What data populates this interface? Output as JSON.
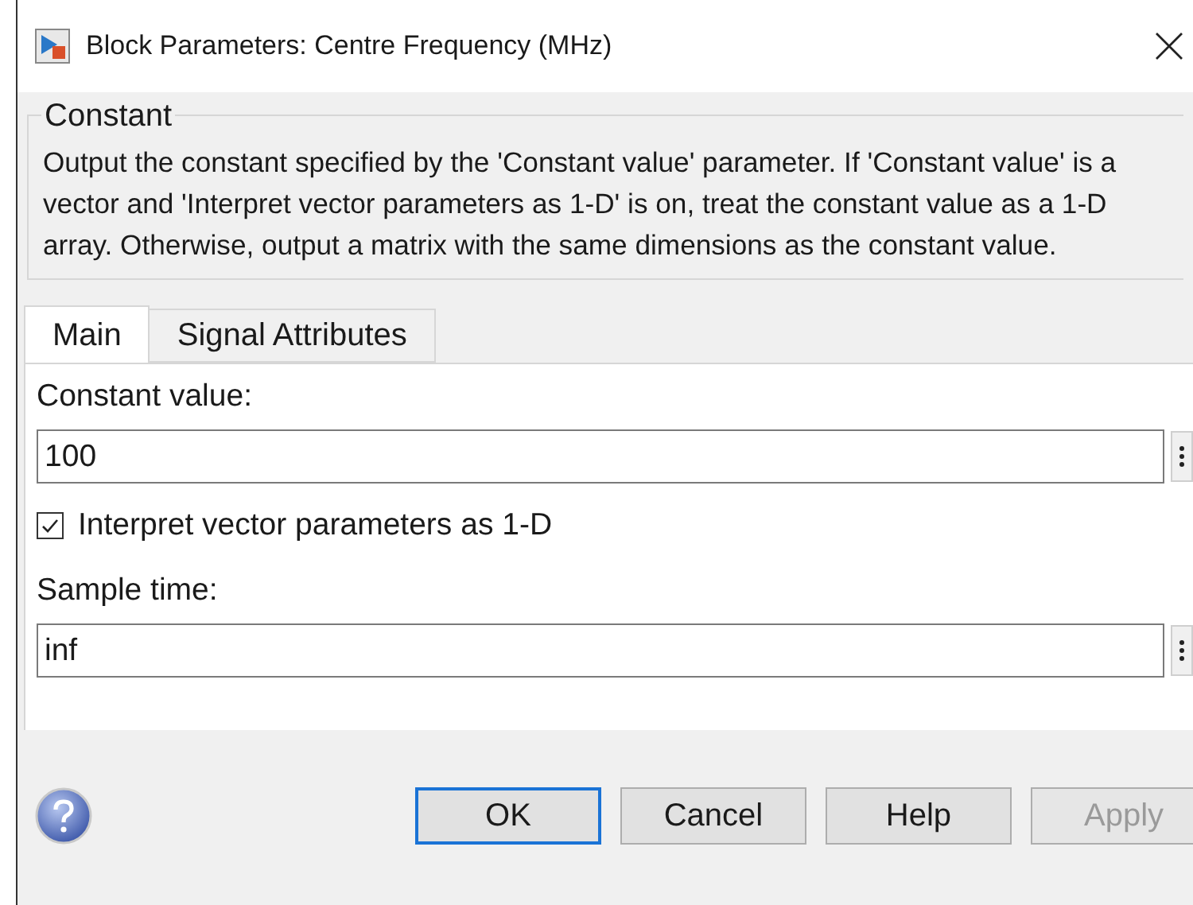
{
  "window": {
    "title": "Block Parameters: Centre Frequency (MHz)"
  },
  "group": {
    "title": "Constant",
    "description": "Output the constant specified by the 'Constant value' parameter. If 'Constant value' is a vector and 'Interpret vector parameters as 1-D' is on, treat the constant value as a 1-D array. Otherwise, output a matrix with the same dimensions as the constant value."
  },
  "tabs": [
    {
      "label": "Main",
      "selected": true
    },
    {
      "label": "Signal Attributes",
      "selected": false
    }
  ],
  "parameters": [
    {
      "kind": "field",
      "label": "Constant value:",
      "value": "100"
    },
    {
      "kind": "checkbox",
      "label": "Interpret vector parameters as 1-D",
      "checked": true
    },
    {
      "kind": "field",
      "label": "Sample time:",
      "value": "inf"
    }
  ],
  "buttons": [
    {
      "label": "OK",
      "default": true,
      "disabled": false
    },
    {
      "label": "Cancel",
      "default": false,
      "disabled": false
    },
    {
      "label": "Help",
      "default": false,
      "disabled": false
    },
    {
      "label": "Apply",
      "default": false,
      "disabled": true
    }
  ]
}
